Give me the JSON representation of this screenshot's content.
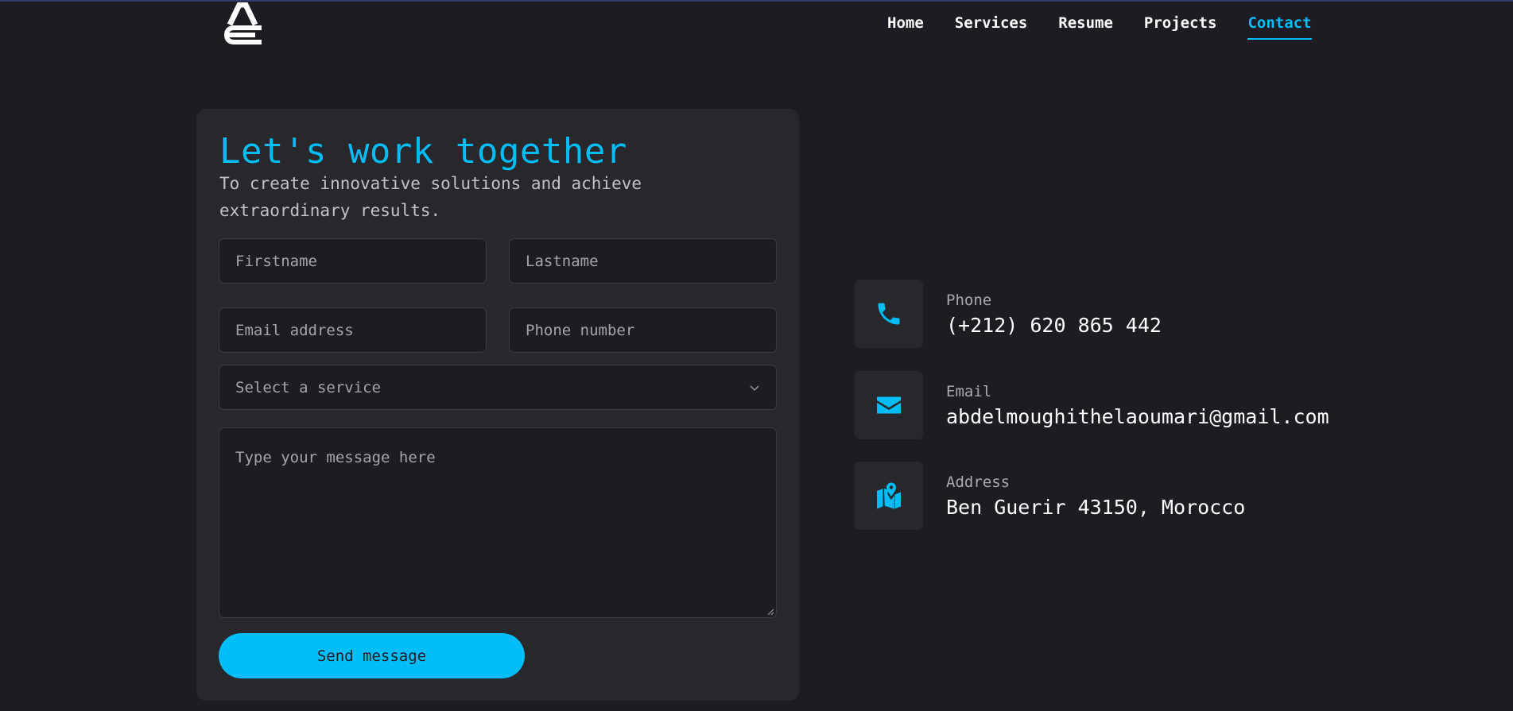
{
  "colors": {
    "accent": "#00bdf7",
    "background": "#1c1c22",
    "surface": "#27272c"
  },
  "header": {
    "logo_icon": "ae-monogram-logo",
    "nav": [
      {
        "label": "Home",
        "active": false
      },
      {
        "label": "Services",
        "active": false
      },
      {
        "label": "Resume",
        "active": false
      },
      {
        "label": "Projects",
        "active": false
      },
      {
        "label": "Contact",
        "active": true
      }
    ]
  },
  "form": {
    "title": "Let's work together",
    "subtitle": "To create innovative solutions and achieve extraordinary results.",
    "firstname_placeholder": "Firstname",
    "lastname_placeholder": "Lastname",
    "email_placeholder": "Email address",
    "phone_placeholder": "Phone number",
    "service_placeholder": "Select a service",
    "message_placeholder": "Type your message here",
    "submit_label": "Send message"
  },
  "info": [
    {
      "icon": "phone-icon",
      "label": "Phone",
      "value": "(+212) 620 865 442"
    },
    {
      "icon": "envelope-icon",
      "label": "Email",
      "value": "abdelmoughithelaoumari@gmail.com"
    },
    {
      "icon": "map-pin-icon",
      "label": "Address",
      "value": "Ben Guerir 43150, Morocco"
    }
  ]
}
